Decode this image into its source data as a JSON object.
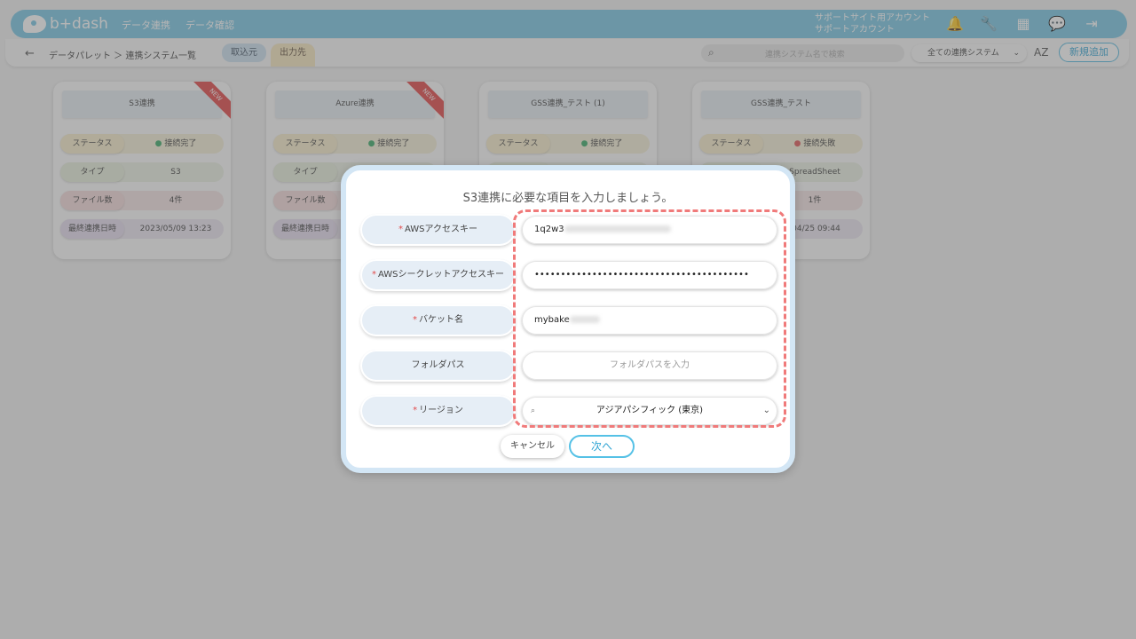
{
  "header": {
    "logo_text": "b+dash",
    "nav": [
      "データ連携",
      "データ確認"
    ],
    "support_line1": "サポートサイト用アカウント",
    "support_line2": "サポートアカウント",
    "icons": [
      "bell-icon",
      "wrench-icon",
      "grid-icon",
      "chat-icon",
      "logout-icon"
    ]
  },
  "subbar": {
    "back": "←",
    "breadcrumb": "データパレット ＞ 連携システム一覧",
    "tab_in": "取込元",
    "tab_out": "出力先",
    "search_placeholder": "連携システム名で検索",
    "filter_value": "全ての連携システム",
    "sort_label": "AZ",
    "add_new": "新規追加"
  },
  "card_labels": {
    "status": "ステータス",
    "type": "タイプ",
    "files": "ファイル数",
    "last_sync": "最終連携日時"
  },
  "cards": [
    {
      "title": "S3連携",
      "badge": "NEW",
      "status": "接続完了",
      "status_ok": true,
      "type": "S3",
      "files": "4件",
      "last_sync": "2023/05/09 13:23"
    },
    {
      "title": "Azure連携",
      "badge": "NEW",
      "status": "接続完了",
      "status_ok": true,
      "type": "",
      "files": "",
      "last_sync": ""
    },
    {
      "title": "GSS連携_テスト (1)",
      "badge": "",
      "status": "接続完了",
      "status_ok": true,
      "type": "",
      "files": "",
      "last_sync": ""
    },
    {
      "title": "GSS連携_テスト",
      "badge": "",
      "status": "接続失敗",
      "status_ok": false,
      "type": "SpreadSheet",
      "files": "1件",
      "last_sync": "/04/25 09:44"
    }
  ],
  "modal": {
    "title": "S3連携に必要な項目を入力しましょう。",
    "fields": [
      {
        "label": "AWSアクセスキー",
        "required": true,
        "value": "1q2w3",
        "masked": true
      },
      {
        "label": "AWSシークレットアクセスキー",
        "required": true,
        "value": "•••••••••••••••••••••••••••••••••••••••••"
      },
      {
        "label": "バケット名",
        "required": true,
        "value": "mybake",
        "masked": true
      },
      {
        "label": "フォルダパス",
        "required": false,
        "value": "",
        "placeholder": "フォルダパスを入力"
      },
      {
        "label": "リージョン",
        "required": true,
        "value": "アジアパシフィック (東京)"
      }
    ],
    "cancel": "キャンセル",
    "next": "次へ"
  },
  "colors": {
    "accent": "#7ac7e3",
    "highlight": "#f07a7a",
    "required": "#e24a4a"
  }
}
